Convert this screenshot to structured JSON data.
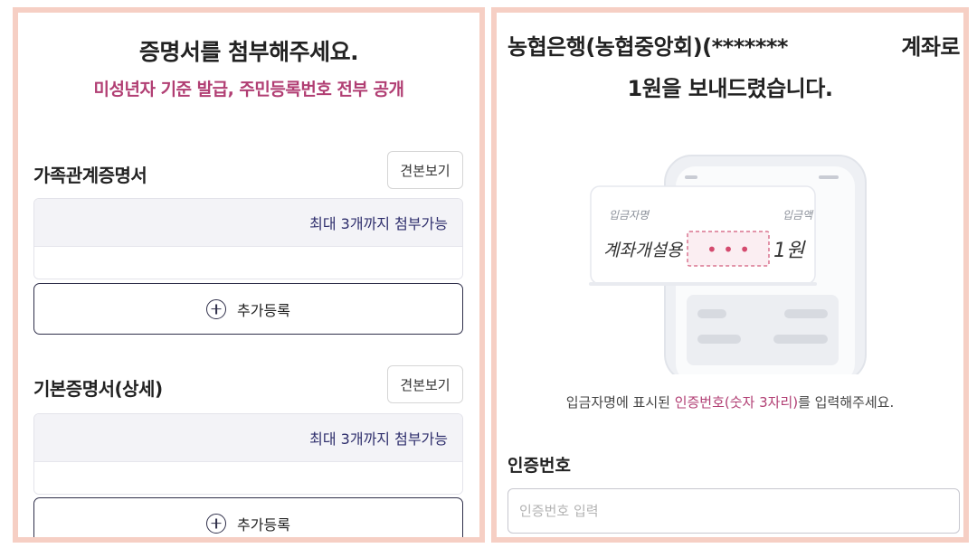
{
  "left": {
    "title": "증명서를 첨부해주세요.",
    "subtitle": "미성년자 기준 발급, 주민등록번호 전부 공개",
    "sections": [
      {
        "title": "가족관계증명서",
        "sample_label": "견본보기",
        "limit_text": "최대 3개까지 첨부가능",
        "add_label": "추가등록"
      },
      {
        "title": "기본증명서(상세)",
        "sample_label": "견본보기",
        "limit_text": "최대 3개까지 첨부가능",
        "add_label": "추가등록"
      }
    ]
  },
  "right": {
    "heading_start": "농협은행(농협중앙회)(*******",
    "heading_end": "계좌로",
    "heading_line2": "1원을 보내드렸습니다.",
    "illustration": {
      "depositor_label": "입금자명",
      "amount_label": "입금액",
      "depositor_value": "계좌개설용",
      "code_dots": "• • •",
      "amount_value": "1원"
    },
    "instruction_before": "입금자명에 표시된 ",
    "instruction_highlight": "인증번호(숫자 3자리)",
    "instruction_after": "를 입력해주세요.",
    "code_label": "인증번호",
    "code_placeholder": "인증번호 입력",
    "code_value": ""
  },
  "colors": {
    "frame_border": "#f6cfc4",
    "accent": "#b13e73",
    "navy": "#2e2e6c"
  }
}
